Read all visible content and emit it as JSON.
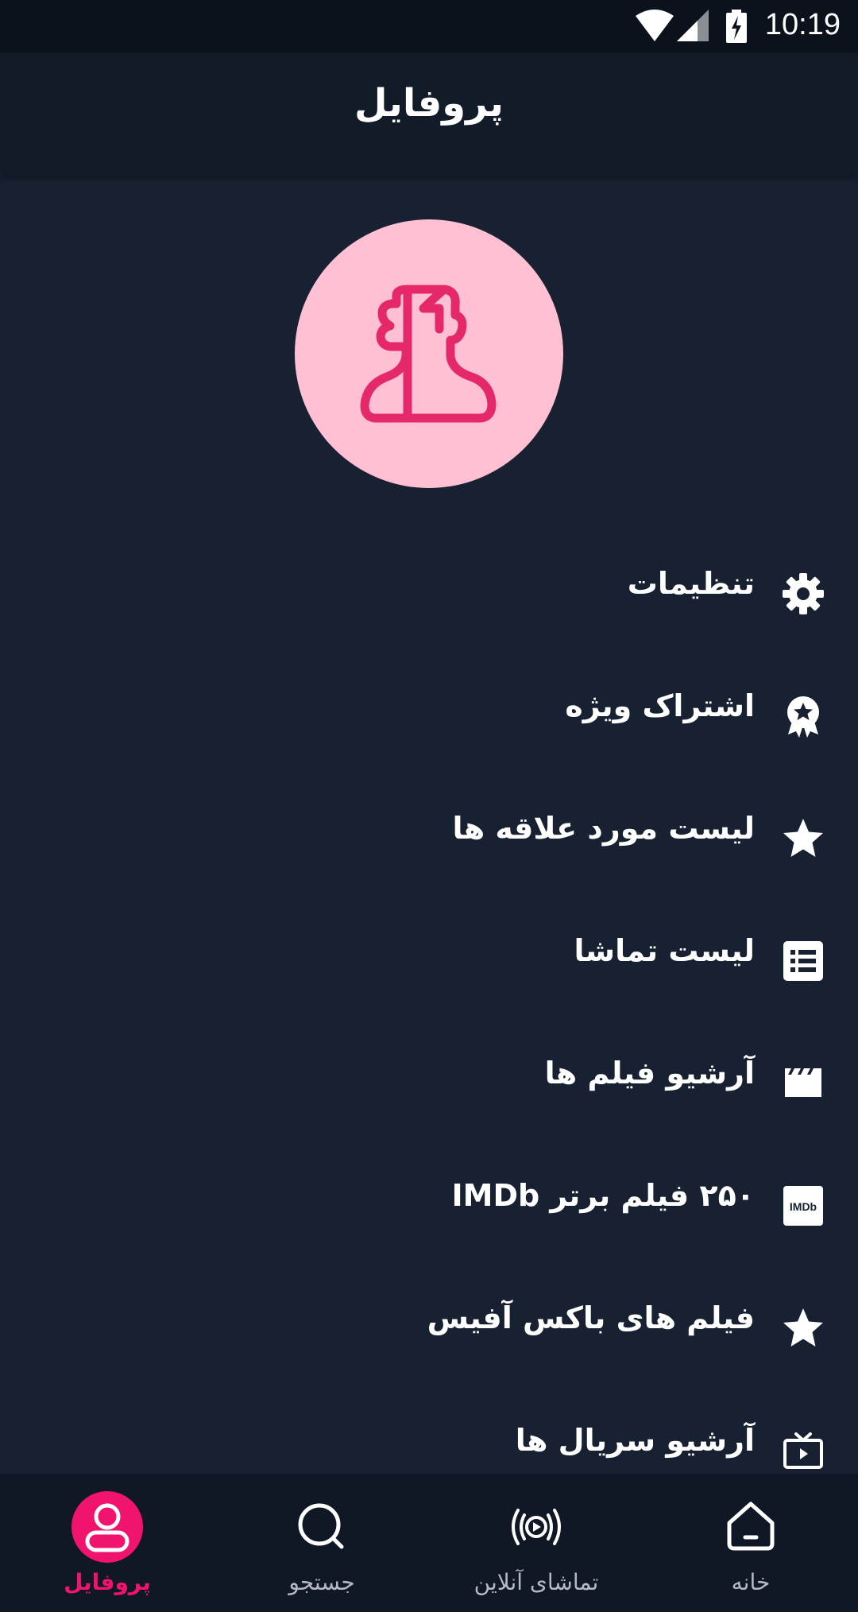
{
  "status_bar": {
    "time": "10:19"
  },
  "header": {
    "title": "پروفایل"
  },
  "avatar": {
    "icon": "user-silhouette-icon",
    "bg_color": "#ffc0d3",
    "icon_color": "#e5286a"
  },
  "menu": {
    "items": [
      {
        "label": "تنظیمات",
        "icon": "gear-icon"
      },
      {
        "label": "اشتراک ویژه",
        "icon": "award-badge-icon"
      },
      {
        "label": "لیست مورد علاقه ها",
        "icon": "star-icon"
      },
      {
        "label": "لیست تماشا",
        "icon": "list-icon"
      },
      {
        "label": "آرشیو فیلم ها",
        "icon": "clapperboard-icon"
      },
      {
        "label": "۲۵۰ فیلم برتر IMDb",
        "icon": "imdb-icon",
        "icon_text": "IMDb"
      },
      {
        "label": "فیلم های باکس آفیس",
        "icon": "star-icon"
      },
      {
        "label": "آرشیو سریال ها",
        "icon": "tv-icon"
      }
    ]
  },
  "bottom_nav": {
    "items": [
      {
        "label": "خانه",
        "icon": "home-icon",
        "active": false
      },
      {
        "label": "تماشای آنلاین",
        "icon": "live-stream-icon",
        "active": false
      },
      {
        "label": "جستجو",
        "icon": "search-icon",
        "active": false
      },
      {
        "label": "پروفایل",
        "icon": "profile-icon",
        "active": true
      }
    ]
  },
  "colors": {
    "accent": "#f0146e",
    "background": "#172131",
    "header": "#121b28",
    "nav_bar": "#101826"
  }
}
